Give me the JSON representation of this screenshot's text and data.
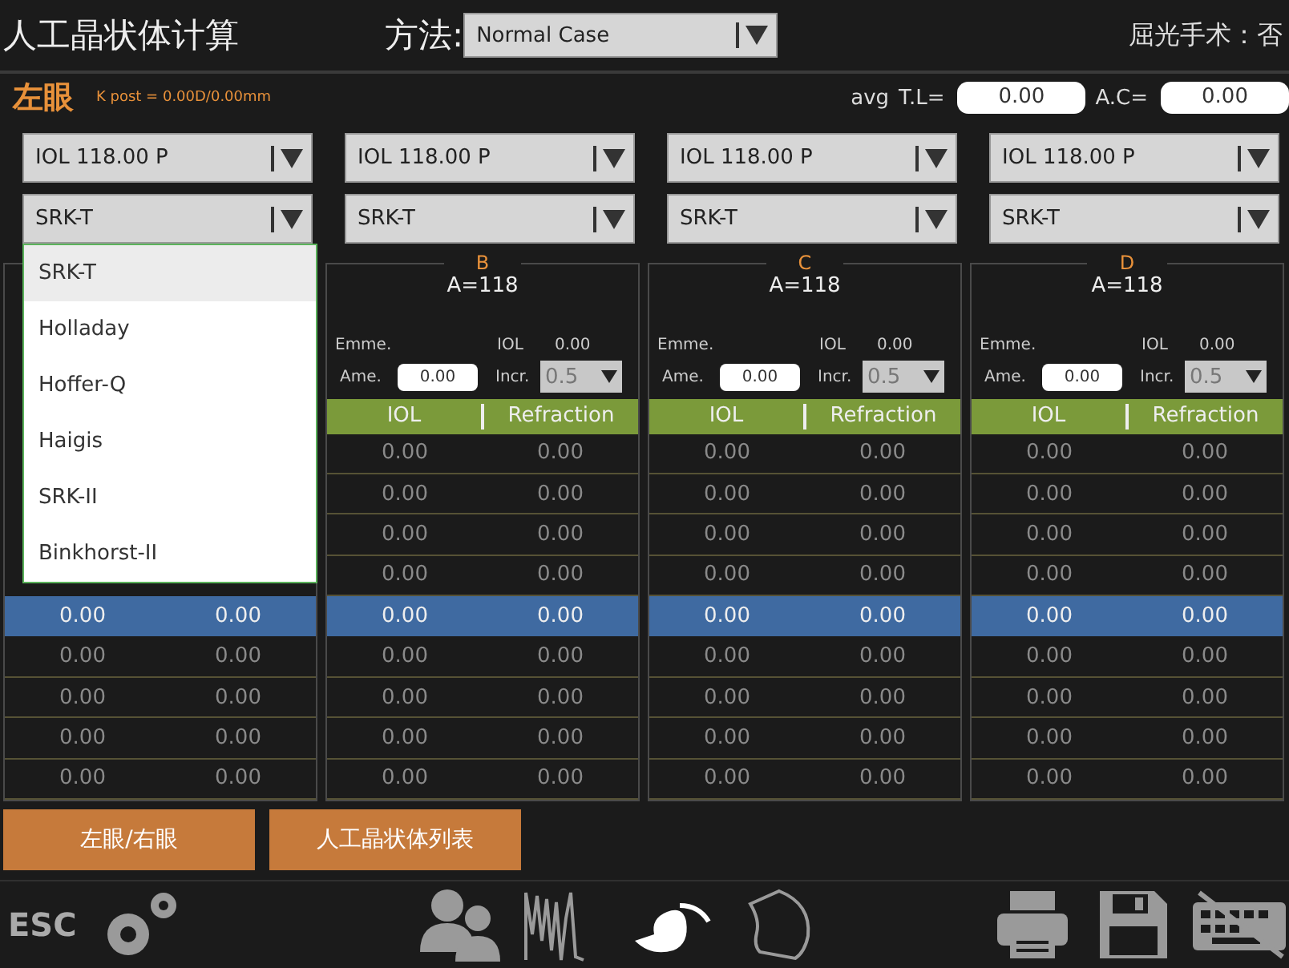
{
  "header": {
    "title": "人工晶状体计算",
    "method_label": "方法:",
    "method": "Normal Case",
    "refractive_surgery": "屈光手术：否"
  },
  "eye": {
    "label": "左眼",
    "k_post": "K post = 0.00D/0.00mm",
    "avg_label": "avg",
    "tl_label": "T.L=",
    "tl": "0.00",
    "ac_label": "A.C=",
    "ac": "0.00"
  },
  "columns": [
    {
      "lens": "IOL 118.00 P",
      "formula": "SRK-T",
      "formula_menu": [
        {
          "label": "SRK-T",
          "selected": true
        },
        {
          "label": "Holladay",
          "selected": false
        },
        {
          "label": "Hoffer-Q",
          "selected": false
        },
        {
          "label": "Haigis",
          "selected": false
        },
        {
          "label": "SRK-II",
          "selected": false
        },
        {
          "label": "Binkhorst-II",
          "selected": false
        }
      ],
      "rows": [
        {
          "iol": "0.00",
          "refraction": "0.00",
          "selected": true
        },
        {
          "iol": "0.00",
          "refraction": "0.00",
          "selected": false
        },
        {
          "iol": "0.00",
          "refraction": "0.00",
          "selected": false
        },
        {
          "iol": "0.00",
          "refraction": "0.00",
          "selected": false
        },
        {
          "iol": "0.00",
          "refraction": "0.00",
          "selected": false
        }
      ]
    },
    {
      "lens": "IOL 118.00 P",
      "formula": "SRK-T",
      "letter": "B",
      "a_constant": "A=118",
      "emme_label": "Emme.",
      "iol_label": "IOL",
      "iol_value": "0.00",
      "ame_label": "Ame.",
      "ame": "0.00",
      "incr_label": "Incr.",
      "incr": "0.5",
      "headers": [
        "IOL",
        "Refraction"
      ],
      "rows": [
        {
          "iol": "0.00",
          "refraction": "0.00",
          "selected": false
        },
        {
          "iol": "0.00",
          "refraction": "0.00",
          "selected": false
        },
        {
          "iol": "0.00",
          "refraction": "0.00",
          "selected": false
        },
        {
          "iol": "0.00",
          "refraction": "0.00",
          "selected": false
        },
        {
          "iol": "0.00",
          "refraction": "0.00",
          "selected": true
        },
        {
          "iol": "0.00",
          "refraction": "0.00",
          "selected": false
        },
        {
          "iol": "0.00",
          "refraction": "0.00",
          "selected": false
        },
        {
          "iol": "0.00",
          "refraction": "0.00",
          "selected": false
        },
        {
          "iol": "0.00",
          "refraction": "0.00",
          "selected": false
        }
      ]
    },
    {
      "lens": "IOL 118.00 P",
      "formula": "SRK-T",
      "letter": "C",
      "a_constant": "A=118",
      "emme_label": "Emme.",
      "iol_label": "IOL",
      "iol_value": "0.00",
      "ame_label": "Ame.",
      "ame": "0.00",
      "incr_label": "Incr.",
      "incr": "0.5",
      "headers": [
        "IOL",
        "Refraction"
      ],
      "rows": [
        {
          "iol": "0.00",
          "refraction": "0.00",
          "selected": false
        },
        {
          "iol": "0.00",
          "refraction": "0.00",
          "selected": false
        },
        {
          "iol": "0.00",
          "refraction": "0.00",
          "selected": false
        },
        {
          "iol": "0.00",
          "refraction": "0.00",
          "selected": false
        },
        {
          "iol": "0.00",
          "refraction": "0.00",
          "selected": true
        },
        {
          "iol": "0.00",
          "refraction": "0.00",
          "selected": false
        },
        {
          "iol": "0.00",
          "refraction": "0.00",
          "selected": false
        },
        {
          "iol": "0.00",
          "refraction": "0.00",
          "selected": false
        },
        {
          "iol": "0.00",
          "refraction": "0.00",
          "selected": false
        }
      ]
    },
    {
      "lens": "IOL 118.00 P",
      "formula": "SRK-T",
      "letter": "D",
      "a_constant": "A=118",
      "emme_label": "Emme.",
      "iol_label": "IOL",
      "iol_value": "0.00",
      "ame_label": "Ame.",
      "ame": "0.00",
      "incr_label": "Incr.",
      "incr": "0.5",
      "headers": [
        "IOL",
        "Refraction"
      ],
      "rows": [
        {
          "iol": "0.00",
          "refraction": "0.00",
          "selected": false
        },
        {
          "iol": "0.00",
          "refraction": "0.00",
          "selected": false
        },
        {
          "iol": "0.00",
          "refraction": "0.00",
          "selected": false
        },
        {
          "iol": "0.00",
          "refraction": "0.00",
          "selected": false
        },
        {
          "iol": "0.00",
          "refraction": "0.00",
          "selected": true
        },
        {
          "iol": "0.00",
          "refraction": "0.00",
          "selected": false
        },
        {
          "iol": "0.00",
          "refraction": "0.00",
          "selected": false
        },
        {
          "iol": "0.00",
          "refraction": "0.00",
          "selected": false
        },
        {
          "iol": "0.00",
          "refraction": "0.00",
          "selected": false
        }
      ]
    }
  ],
  "buttons": [
    "左眼/右眼",
    "人工晶状体列表"
  ],
  "toolbar": {
    "esc": "ESC"
  }
}
